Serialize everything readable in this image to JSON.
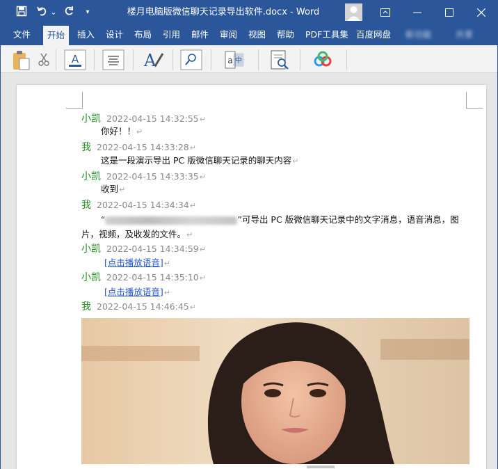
{
  "titlebar": {
    "doc_title": "楼月电脑版微信聊天记录导出软件.docx  -  Word",
    "undo_dropdown": "⌄",
    "customize": "▾"
  },
  "tabs": [
    {
      "label": "文件"
    },
    {
      "label": "开始"
    },
    {
      "label": "插入"
    },
    {
      "label": "设计"
    },
    {
      "label": "布局"
    },
    {
      "label": "引用"
    },
    {
      "label": "邮件"
    },
    {
      "label": "审阅"
    },
    {
      "label": "视图"
    },
    {
      "label": "帮助"
    },
    {
      "label": "PDF工具集"
    },
    {
      "label": "百度网盘"
    },
    {
      "label": "新功能"
    },
    {
      "label": "共享"
    }
  ],
  "messages": [
    {
      "sender": "小凯",
      "time": "2022-04-15 14:32:55",
      "text": "你好！！"
    },
    {
      "sender": "我",
      "time": "2022-04-15 14:33:28",
      "text": "这是一段演示导出 PC 版微信聊天记录的聊天内容"
    },
    {
      "sender": "小凯",
      "time": "2022-04-15 14:33:35",
      "text": "收到"
    },
    {
      "sender": "我",
      "time": "2022-04-15 14:34:34",
      "text_open": "“",
      "text_rest": "”可导出 PC 版微信聊天记录中的文字消息，语音消息，图片，视频，及收发的文件。"
    },
    {
      "sender": "小凯",
      "time": "2022-04-15 14:34:59",
      "voice": "[点击播放语音]"
    },
    {
      "sender": "小凯",
      "time": "2022-04-15 14:35:10",
      "voice": "[点击播放语音]"
    },
    {
      "sender": "我",
      "time": "2022-04-15 14:46:45"
    }
  ],
  "paragraph_mark": "↵",
  "colors": {
    "word_blue": "#2b579a",
    "sender_green": "#1e8f1e",
    "timestamp_gray": "#8a8a8a",
    "link_blue": "#2255cc"
  }
}
